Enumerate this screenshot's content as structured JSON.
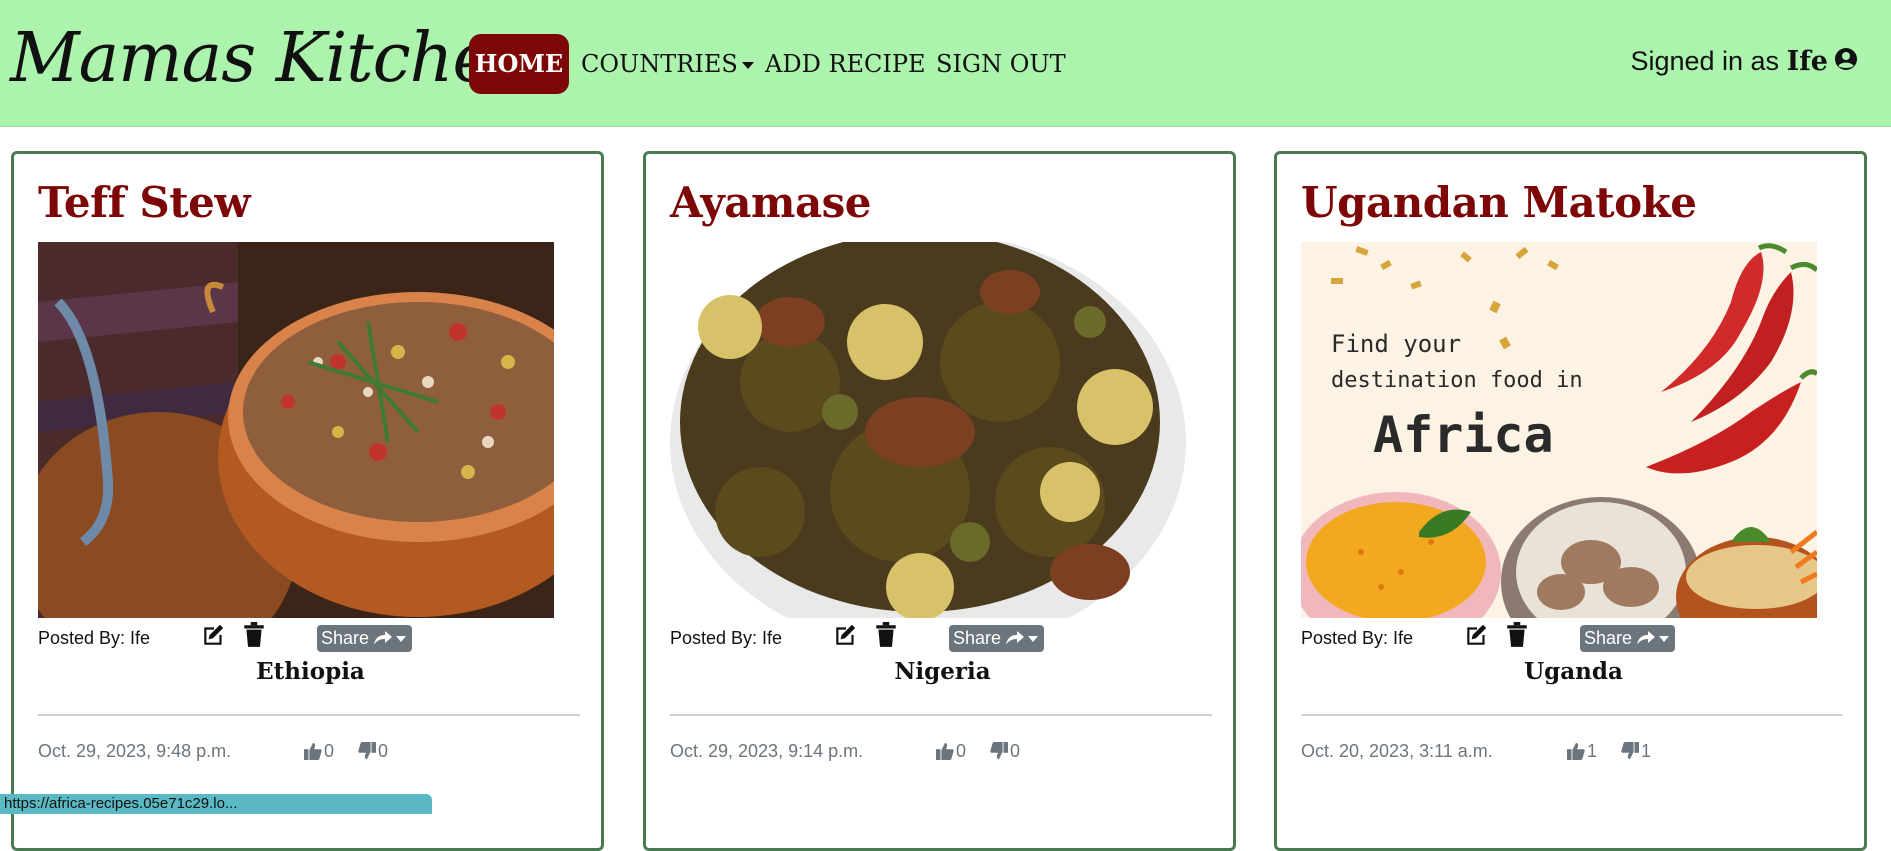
{
  "navbar": {
    "brand": "Mamas Kitchen",
    "links": [
      "HOME",
      "COUNTRIES",
      "ADD RECIPE",
      "SIGN OUT"
    ],
    "signed_in_prefix": "Signed in as",
    "username": "Ife",
    "colors": {
      "background": "#acf3ae",
      "active": "#7d0707"
    }
  },
  "cards": [
    {
      "title": "Teff Stew",
      "posted_by": "Posted By: Ife",
      "share_label": "Share",
      "country": "Ethiopia",
      "date": "Oct. 29, 2023, 9:48 p.m.",
      "likes": "0",
      "dislikes": "0"
    },
    {
      "title": "Ayamase",
      "posted_by": "Posted By: Ife",
      "share_label": "Share",
      "country": "Nigeria",
      "date": "Oct. 29, 2023, 9:14 p.m.",
      "likes": "0",
      "dislikes": "0"
    },
    {
      "title": "Ugandan Matoke",
      "posted_by": "Posted By: Ife",
      "share_label": "Share",
      "country": "Uganda",
      "date": "Oct. 20, 2023, 3:11 a.m.",
      "likes": "1",
      "dislikes": "1",
      "image_text": [
        "Find your",
        "destination food in",
        "Africa"
      ]
    }
  ],
  "status_url": "https://africa-recipes.05e71c29.lo..."
}
